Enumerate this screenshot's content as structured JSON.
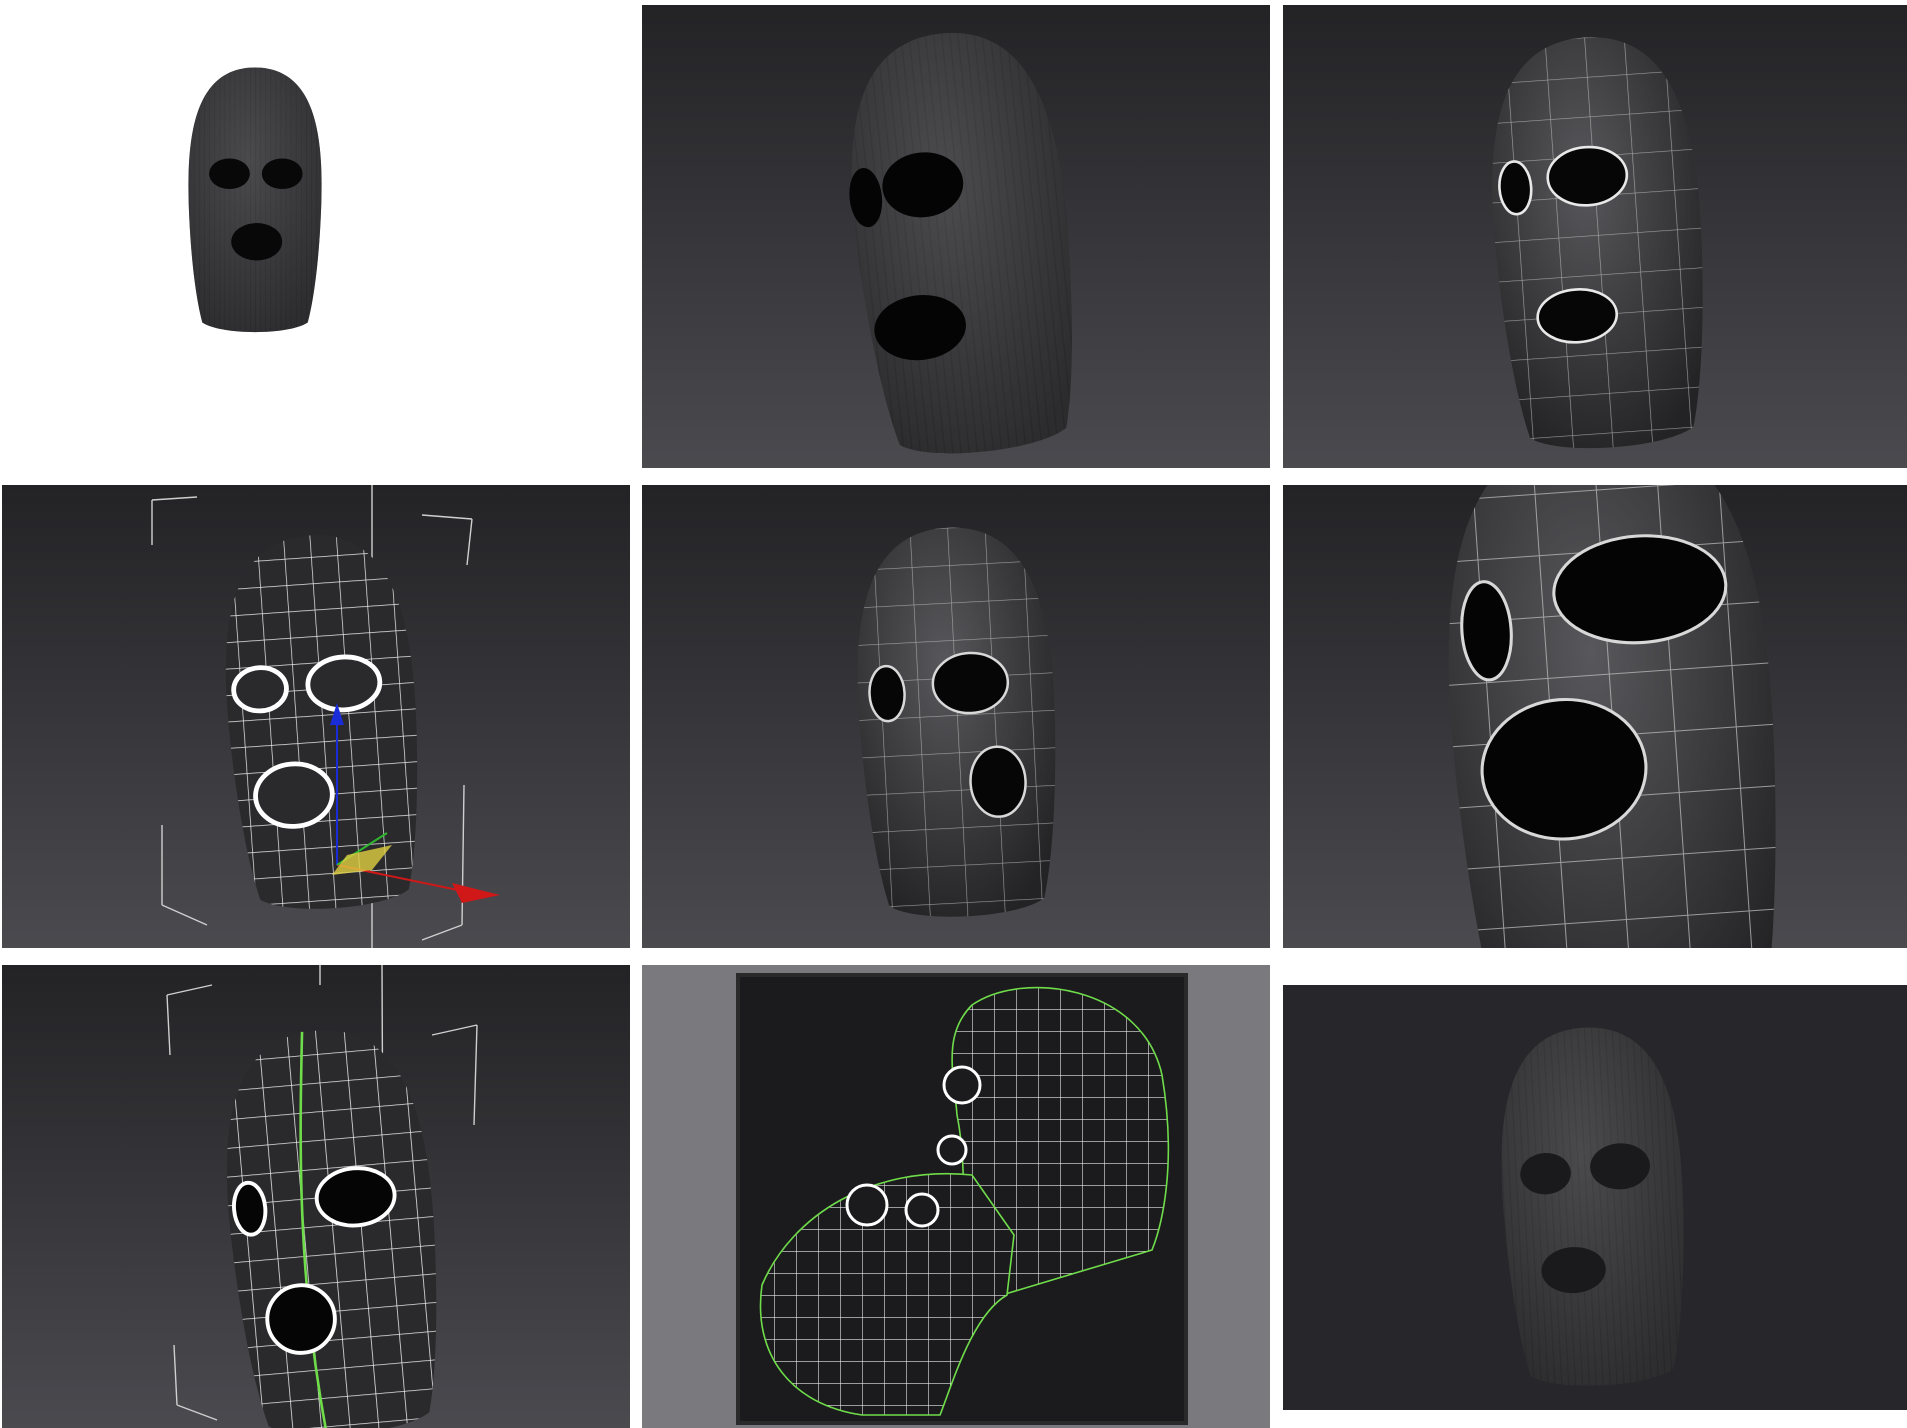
{
  "gallery": {
    "tiles": [
      {
        "view": "render",
        "background": "white"
      },
      {
        "view": "render",
        "background": "dark-gradient"
      },
      {
        "view": "wireframe-shaded",
        "background": "dark-gradient"
      },
      {
        "view": "wireframe-with-gizmo",
        "background": "dark-gradient"
      },
      {
        "view": "wireframe-shaded",
        "background": "dark-gradient"
      },
      {
        "view": "wireframe-closeup",
        "background": "dark-gradient"
      },
      {
        "view": "uv-seams",
        "background": "dark-gradient"
      },
      {
        "view": "uv-layout",
        "background": "grey"
      },
      {
        "view": "render",
        "background": "dark"
      }
    ]
  },
  "colors": {
    "mask": "#3a3a3c",
    "hole": "#050505",
    "wire": "#e8e8e8",
    "seam": "#6fdc4a",
    "gizmo_x": "#d01818",
    "gizmo_z": "#1a2cd8",
    "gizmo_y": "#2fb82f",
    "gizmo_plane": "#e0d040"
  },
  "icons": [
    "mask-render",
    "mask-wireframe",
    "transform-gizmo-icon",
    "uv-island"
  ]
}
